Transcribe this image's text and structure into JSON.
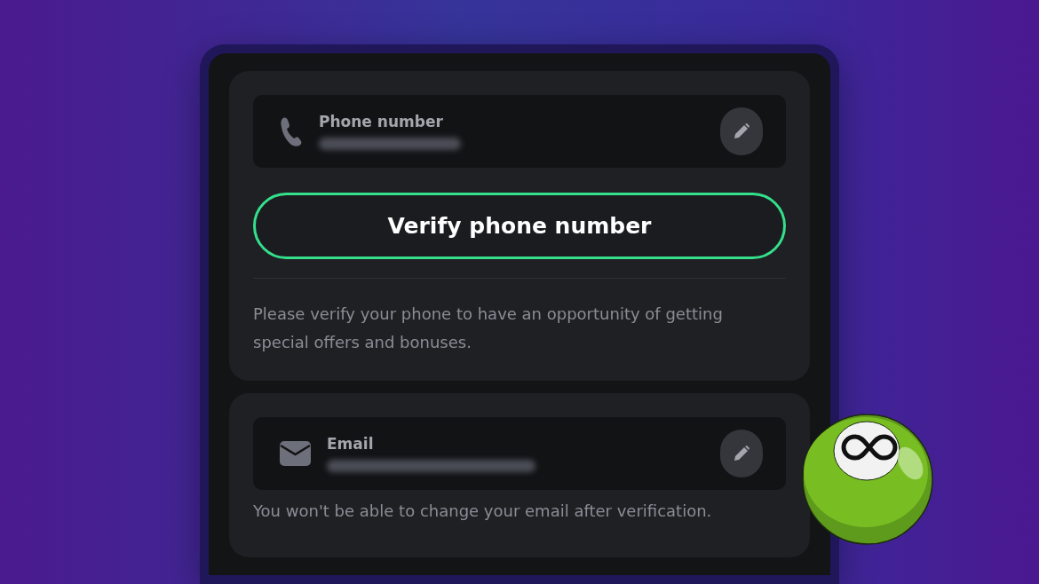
{
  "phone_card": {
    "field": {
      "label": "Phone number",
      "value_redacted": true
    },
    "verify_button": "Verify phone number",
    "note": "Please verify your phone to have an opportunity of getting special offers and bonuses."
  },
  "email_card": {
    "field": {
      "label": "Email",
      "value_redacted": true
    },
    "note": "You won't be able to change your email after verification."
  }
}
